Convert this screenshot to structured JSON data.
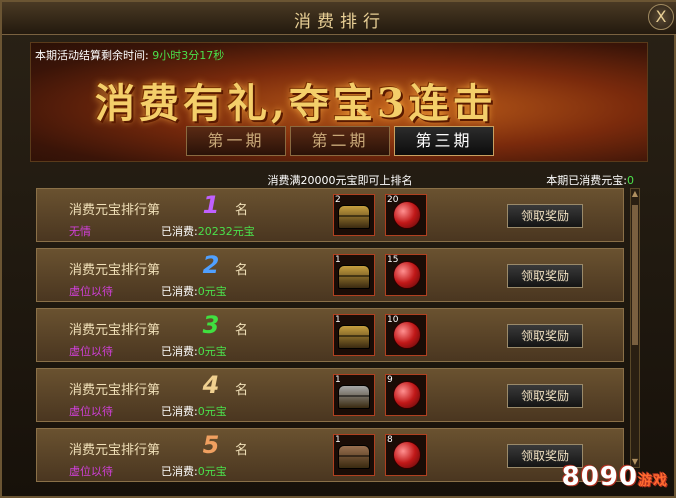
{
  "window": {
    "title": "消费排行",
    "close_label": "X"
  },
  "banner": {
    "countdown_label": "本期活动结算剩余时间:",
    "countdown_value": "9小时3分17秒",
    "slogan": "消费有礼,夺宝3连击"
  },
  "tabs": [
    {
      "label": "第一期",
      "active": false
    },
    {
      "label": "第二期",
      "active": false
    },
    {
      "label": "第三期",
      "active": true
    }
  ],
  "rule_text": "消费满20000元宝即可上排名",
  "period_spent": {
    "label": "本期已消费元宝:",
    "value": "0"
  },
  "rank_prefix": "消费元宝排行第",
  "rank_suffix": "名",
  "spent_label": "已消费:",
  "claim_label": "领取奖励",
  "rows": [
    {
      "rank": "1",
      "rank_color": "#c060ff",
      "player": "无情",
      "spent": "20232元宝",
      "chest_count": "2",
      "chest_color": "gold",
      "gem_count": "20"
    },
    {
      "rank": "2",
      "rank_color": "#50a0ff",
      "player": "虚位以待",
      "spent": "0元宝",
      "chest_count": "1",
      "chest_color": "gold",
      "gem_count": "15"
    },
    {
      "rank": "3",
      "rank_color": "#40e040",
      "player": "虚位以待",
      "spent": "0元宝",
      "chest_count": "1",
      "chest_color": "gold",
      "gem_count": "10"
    },
    {
      "rank": "4",
      "rank_color": "#f0d090",
      "player": "虚位以待",
      "spent": "0元宝",
      "chest_count": "1",
      "chest_color": "silver",
      "gem_count": "9"
    },
    {
      "rank": "5",
      "rank_color": "#f0a060",
      "player": "虚位以待",
      "spent": "0元宝",
      "chest_count": "1",
      "chest_color": "bronze",
      "gem_count": "8"
    }
  ],
  "chest_colors": {
    "gold": "#c8a040",
    "silver": "#a8a8a8",
    "bronze": "#9a7050"
  },
  "watermark": {
    "brand": "8090",
    "suffix": "游戏"
  }
}
